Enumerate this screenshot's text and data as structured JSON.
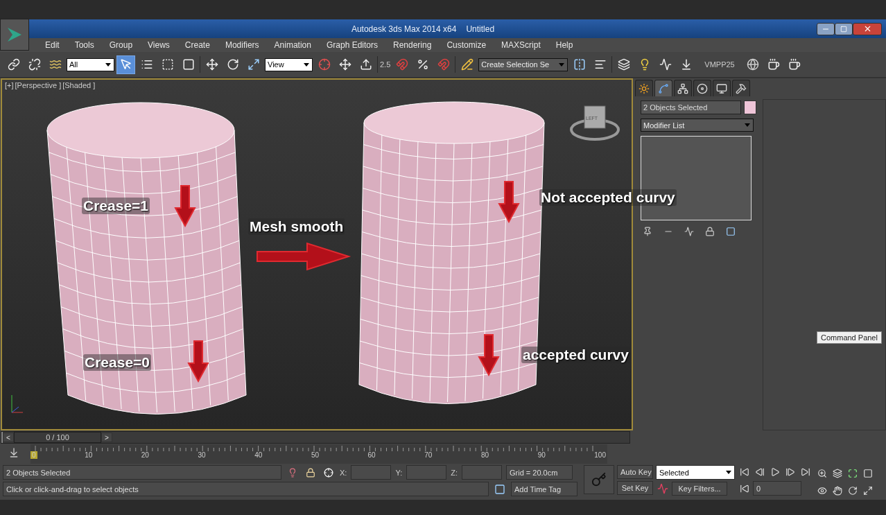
{
  "window": {
    "title": "Autodesk 3ds Max  2014 x64",
    "document": "Untitled"
  },
  "menu": [
    {
      "label": "Edit"
    },
    {
      "label": "Tools"
    },
    {
      "label": "Group"
    },
    {
      "label": "Views"
    },
    {
      "label": "Create"
    },
    {
      "label": "Modifiers"
    },
    {
      "label": "Animation"
    },
    {
      "label": "Graph Editors"
    },
    {
      "label": "Rendering"
    },
    {
      "label": "Customize"
    },
    {
      "label": "MAXScript"
    },
    {
      "label": "Help"
    }
  ],
  "toolbar": {
    "selection_filter": "All",
    "reference_coord": "View",
    "snap_angle": "2.5",
    "named_selection": "Create Selection Se",
    "label": "VMPP25"
  },
  "viewport": {
    "labels": [
      "[+]",
      "[Perspective ]",
      "[Shaded ]"
    ],
    "viewcube": "LEFT",
    "annotations": [
      {
        "text": "Crease=1"
      },
      {
        "text": "Mesh smooth"
      },
      {
        "text": "Not accepted curvy"
      },
      {
        "text": "Crease=0"
      },
      {
        "text": "accepted curvy"
      }
    ]
  },
  "command_panel": {
    "tabs": [
      {
        "kind": "create",
        "selected": false
      },
      {
        "kind": "modify",
        "selected": true
      },
      {
        "kind": "hierarchy",
        "selected": false
      },
      {
        "kind": "motion",
        "selected": false
      },
      {
        "kind": "display",
        "selected": false
      },
      {
        "kind": "utilities",
        "selected": false
      }
    ],
    "object_name": "2 Objects Selected",
    "modifier_list": "Modifier List",
    "tooltip": "Command Panel"
  },
  "timeline": {
    "level": 0,
    "prev": "<",
    "frame": "0 / 100",
    "next": ">",
    "ticks": [
      "0",
      "10",
      "20",
      "30",
      "40",
      "50",
      "60",
      "70",
      "80",
      "90",
      "100"
    ]
  },
  "status": {
    "selection": "2 Objects Selected",
    "prompt": "Click or click-and-drag to select objects",
    "x_label": "X:",
    "y_label": "Y:",
    "z_label": "Z:",
    "grid": "Grid = 20.0cm",
    "add_time_tag": "Add Time Tag",
    "auto_key": "Auto Key",
    "set_key": "Set Key",
    "key_mode": "Selected",
    "key_filters": "Key Filters...",
    "current_frame": "0"
  }
}
